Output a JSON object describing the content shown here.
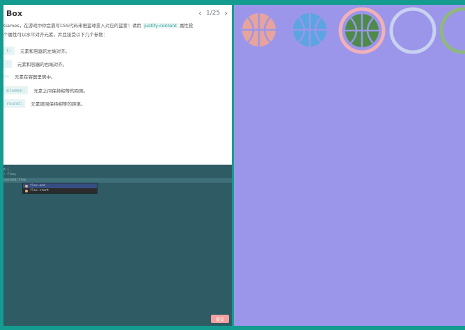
{
  "header": {
    "title": "Box",
    "page_current": "1",
    "page_sep": "/",
    "page_total": "25"
  },
  "intro": {
    "line1_a": "Games，在游戏中你会靠写CSS代码来把篮球投入对应的篮筐！请用",
    "line1_code": "justify-content",
    "line1_b": "属性投",
    "line2": "个属性可以水平对齐元素，并且接受以下几个参数："
  },
  "options": [
    {
      "key": "t:",
      "desc": "元素和容器的左端对齐。"
    },
    {
      "key": ":",
      "desc": "元素和容器的右端对齐。"
    },
    {
      "key": "",
      "desc": "元素在容器里居中。"
    },
    {
      "key": "etween:",
      "desc": "元素之间保持相等的距离。"
    },
    {
      "key": "round:",
      "desc": "元素周围保持相等的距离。"
    }
  ],
  "editor": {
    "lines": [
      "d {",
      ": flex;",
      "content:flex"
    ],
    "autocomplete": [
      "flex-end",
      "flex-start"
    ],
    "submit_label": "提交"
  },
  "colors": {
    "frame": "#139c8f",
    "board": "#9b96ea",
    "editor_bg": "#2f5b64",
    "ball_orange": "#e8a49c",
    "ball_blue": "#5aa5e2",
    "ball_green": "#4e8a4a",
    "ring_pink": "#f2b0b8",
    "ring_white": "#c8d2f0",
    "ring_green": "#8fb87c"
  }
}
